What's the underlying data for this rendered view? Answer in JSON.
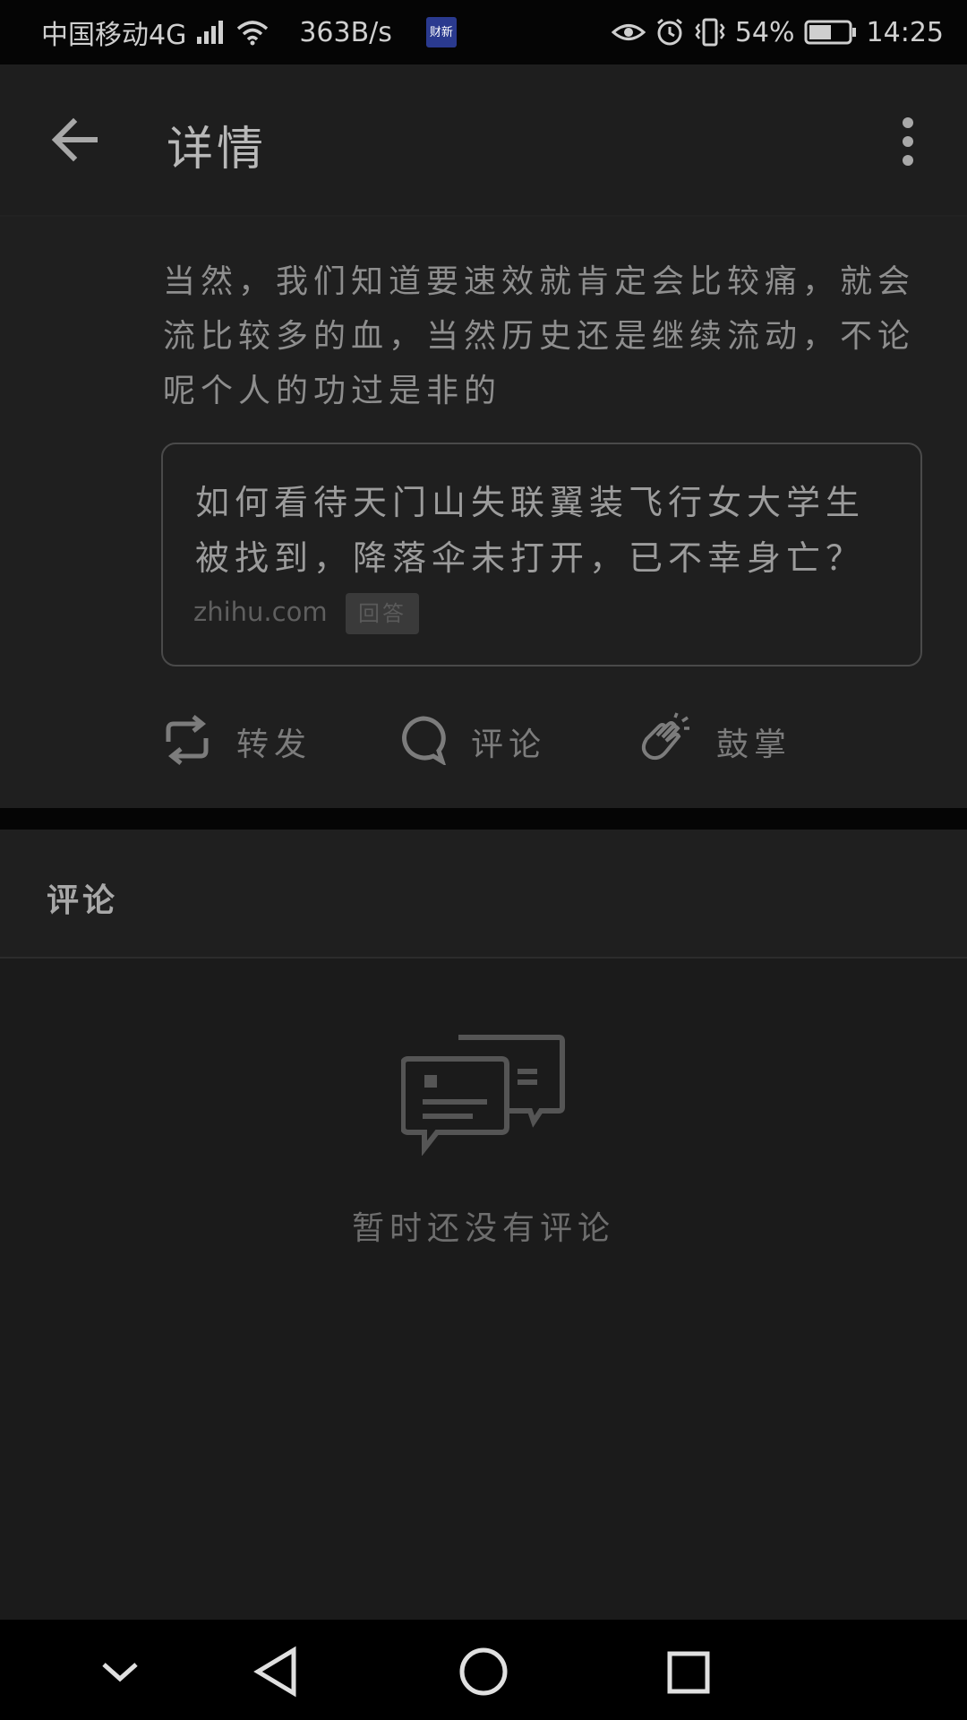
{
  "status_bar": {
    "carrier": "中国移动4G",
    "network_badge": "4G",
    "net_speed": "363B/s",
    "app_badge": "财新",
    "battery_percent": "54%",
    "time": "14:25"
  },
  "app_bar": {
    "title": "详情",
    "back_icon": "arrow-left-icon",
    "more_icon": "more-vertical-icon"
  },
  "post": {
    "text": "当然，我们知道要速效就肯定会比较痛，就会流比较多的血，当然历史还是继续流动，不论呢个人的功过是非的",
    "link_card": {
      "title": "如何看待天门山失联翼装飞行女大学生被找到，降落伞未打开，已不幸身亡？",
      "source": "zhihu.com",
      "tag": "回答"
    },
    "actions": {
      "repost": "转发",
      "comment": "评论",
      "clap": "鼓掌"
    }
  },
  "comments": {
    "header": "评论",
    "empty_text": "暂时还没有评论"
  },
  "colors": {
    "background": "#1b1b1b",
    "status_bar": "#050505",
    "card_border": "#4a4a4a"
  }
}
